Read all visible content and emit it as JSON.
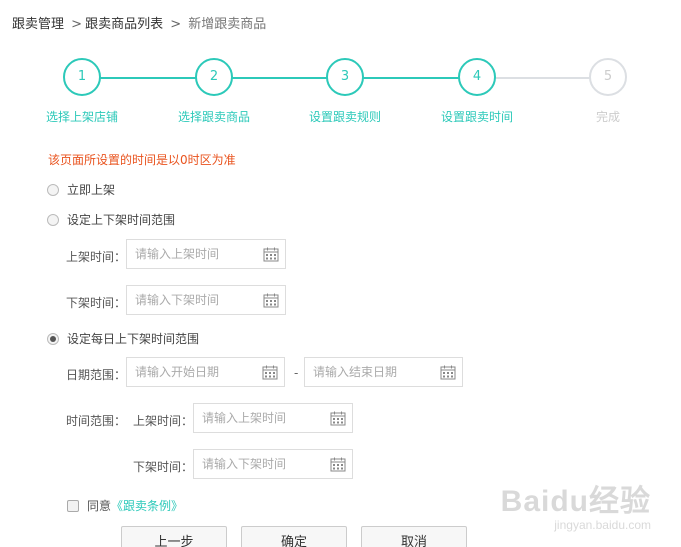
{
  "breadcrumb": {
    "items": [
      "跟卖管理",
      "跟卖商品列表"
    ],
    "separator": ">",
    "current": "新增跟卖商品"
  },
  "steps": [
    {
      "number": "1",
      "label": "选择上架店铺",
      "active": true
    },
    {
      "number": "2",
      "label": "选择跟卖商品",
      "active": true
    },
    {
      "number": "3",
      "label": "设置跟卖规则",
      "active": true
    },
    {
      "number": "4",
      "label": "设置跟卖时间",
      "active": true
    },
    {
      "number": "5",
      "label": "完成",
      "active": false
    }
  ],
  "accent_color": "#2cc9b9",
  "notice_color": "#e9531e",
  "notice": "该页面所设置的时间是以0时区为准",
  "options": {
    "immediate": "立即上架",
    "range": "设定上下架时间范围",
    "daily": "设定每日上下架时间范围",
    "selected": "daily"
  },
  "range_section": {
    "on_label": "上架时间：",
    "on_placeholder": "请输入上架时间",
    "off_label": "下架时间：",
    "off_placeholder": "请输入下架时间"
  },
  "daily_section": {
    "date_label": "日期范围：",
    "start_placeholder": "请输入开始日期",
    "dash": "-",
    "end_placeholder": "请输入结束日期",
    "time_label": "时间范围：",
    "on_label": "上架时间：",
    "on_placeholder": "请输入上架时间",
    "off_label": "下架时间：",
    "off_placeholder": "请输入下架时间"
  },
  "agreement": {
    "text": "同意",
    "link": "《跟卖条例》",
    "checked": false
  },
  "buttons": {
    "prev": "上一步",
    "confirm": "确定",
    "cancel": "取消"
  },
  "watermark": {
    "logo": "Baidu经验",
    "sub": "jingyan.baidu.com"
  },
  "icons": {
    "calendar": "calendar-icon"
  }
}
